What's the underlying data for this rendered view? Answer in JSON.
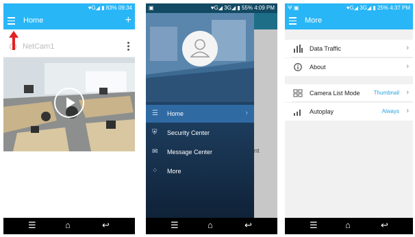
{
  "screen1": {
    "status": {
      "icons": "♥G◢ ▮",
      "battery": "83%",
      "time": "09:34"
    },
    "title": "Home",
    "add_icon": "+",
    "camera": {
      "name": "NetCam1"
    }
  },
  "screen2": {
    "status": {
      "icons": "♥G◢ 3G◢ ▮",
      "battery": "55%",
      "time": "4:09 PM"
    },
    "menu": [
      {
        "label": "Home",
        "icon": "☰"
      },
      {
        "label": "Security Center",
        "icon": "⛨"
      },
      {
        "label": "Message Center",
        "icon": "✉"
      },
      {
        "label": "More",
        "icon": "⁘"
      }
    ],
    "behind_text": "nt"
  },
  "screen3": {
    "status": {
      "icons": "♥G◢ 3G◢ ▮",
      "battery": "25%",
      "time": "4:37 PM"
    },
    "title": "More",
    "rows": [
      {
        "label": "Data Traffic"
      },
      {
        "label": "About"
      },
      {
        "label": "Camera List Mode",
        "value": "Thumbnail"
      },
      {
        "label": "Autoplay",
        "value": "Always"
      }
    ]
  },
  "navbar": {
    "menu_icon": "☰",
    "home_icon": "⌂",
    "back_icon": "↩"
  },
  "colors": {
    "accent": "#29b6f6",
    "drawer": "#1b3a5c",
    "highlight": "#2f6aa3",
    "value_text": "#29a3dd"
  }
}
